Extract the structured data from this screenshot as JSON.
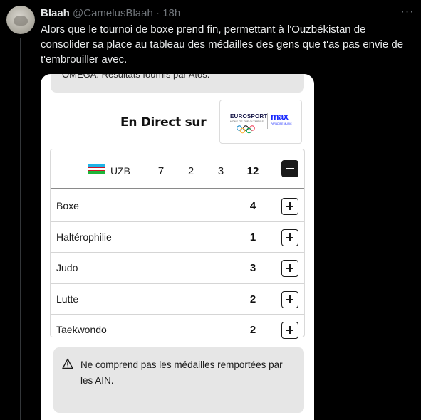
{
  "tweet": {
    "author_name": "Blaah",
    "author_handle": "@CamelusBlaah",
    "separator": "·",
    "time": "18h",
    "more_icon": "more-horizontal-icon",
    "text": "Alors que le tournoi de boxe prend fin, permettant à l'Ouzbékistan de consolider sa place au tableau des médailles des gens que t'as pas envie de t'embrouiller avec."
  },
  "embed": {
    "top_text": "OMEGA. Résultats fournis par Atos.",
    "live_label": "En Direct sur",
    "logo": {
      "eurosport": "EUROSPORT",
      "eurosport_sub": "HOME OF THE OLYMPICS",
      "max": "max",
      "max_sub": "PARADISE MUSIC"
    },
    "country": {
      "code": "UZB",
      "gold": "7",
      "silver": "2",
      "bronze": "3",
      "total": "12",
      "flag_colors": [
        "#1eb3e6",
        "#ffffff",
        "#1eb53a"
      ]
    },
    "sports": [
      {
        "name": "Boxe",
        "count": "4"
      },
      {
        "name": "Haltérophilie",
        "count": "1"
      },
      {
        "name": "Judo",
        "count": "3"
      },
      {
        "name": "Lutte",
        "count": "2"
      },
      {
        "name": "Taekwondo",
        "count": "2"
      }
    ],
    "notice": "Ne comprend pas les médailles remportées par les AIN."
  }
}
